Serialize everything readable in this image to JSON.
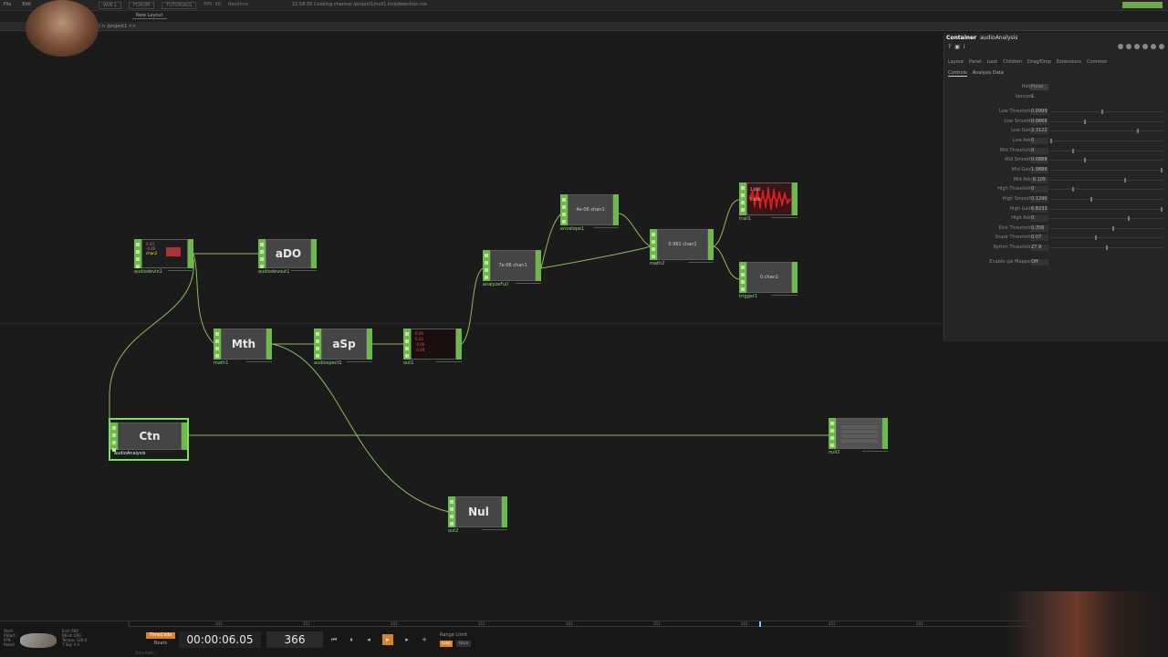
{
  "menubar": {
    "items": [
      "File",
      "Edit"
    ],
    "top_items": [
      "WIN 1",
      "FORUM",
      "TUTORIALS",
      "FPS: 60",
      "Realtime"
    ],
    "status": "22:58:55 Cooking channel /project1/null1 kickdetection.tox"
  },
  "tabs": {
    "new_layout": "New Layout"
  },
  "path": {
    "text": "/ > /project1 >>"
  },
  "nodes": {
    "audiodevin": {
      "label": "audiodevin1",
      "preview_lines": [
        "0.43",
        "-0.46",
        "chan2"
      ]
    },
    "ado": {
      "big": "aDO",
      "label": "audiodevout1"
    },
    "math1": {
      "big": "Mth",
      "label": "math1"
    },
    "asp": {
      "big": "aSp",
      "label": "audiospect1"
    },
    "out1": {
      "label": "out1",
      "preview_lines": [
        "0.40",
        "0.20",
        "-0.00",
        "-0.40"
      ]
    },
    "analyze": {
      "small": "7e-06 chan1",
      "label": "analyzeFull"
    },
    "envelope": {
      "small": "4e-06 chan1",
      "label": "envelope1"
    },
    "math2": {
      "small": "0.981 chan1",
      "label": "math2"
    },
    "trail": {
      "label": "trail1",
      "preview_lines": [
        "1.000",
        "0.000"
      ]
    },
    "trigger": {
      "small": "0 chan1",
      "label": "trigger1"
    },
    "ctn": {
      "big": "Ctn",
      "label": "audioAnalysis"
    },
    "null2": {
      "label": "null2"
    },
    "nul": {
      "big": "Nul",
      "label": "out2"
    }
  },
  "panel": {
    "title_prefix": "Container",
    "title_name": "audioAnalysis",
    "tabs": [
      "Layout",
      "Panel",
      "Look",
      "Children",
      "Drag/Drop",
      "Extensions",
      "Common"
    ],
    "subtabs": [
      "Controls",
      "Analysis Data"
    ],
    "help": {
      "label": "Help",
      "value": "Pulse"
    },
    "version": {
      "label": "Version",
      "value": "1"
    },
    "params": [
      {
        "label": "Low Threshold",
        "value": "0.0999",
        "knob": 0.46
      },
      {
        "label": "Low Smooth",
        "value": "0.0666",
        "knob": 0.3
      },
      {
        "label": "Low Gain",
        "value": "2.3122",
        "knob": 0.78
      },
      {
        "label": "Low Add",
        "value": "0",
        "knob": 0.0
      },
      {
        "label": "Mid Threshold",
        "value": "0",
        "knob": 0.2
      },
      {
        "label": "Mid Smooth",
        "value": "0.0888",
        "knob": 0.3
      },
      {
        "label": "Mid Gain",
        "value": "1.9888",
        "knob": 0.99
      },
      {
        "label": "Mid Add",
        "value": "-0.105",
        "knob": 0.66
      },
      {
        "label": "High Threshold",
        "value": "0",
        "knob": 0.2
      },
      {
        "label": "High Smooth",
        "value": "0.1296",
        "knob": 0.36
      },
      {
        "label": "High Gain",
        "value": "6.8233",
        "knob": 0.99
      },
      {
        "label": "High Add",
        "value": "0",
        "knob": 0.7
      },
      {
        "label": "Kick Threshold",
        "value": "0.356",
        "knob": 0.56
      },
      {
        "label": "Snare Threshold",
        "value": "0.07",
        "knob": 0.4
      },
      {
        "label": "Rythm Threshold",
        "value": "27.9",
        "knob": 0.5
      },
      {
        "label": "Enable gal Mapper",
        "value": "Off",
        "knob": null
      }
    ]
  },
  "timeline": {
    "ticks": [
      "1",
      "101",
      "151",
      "201",
      "251",
      "301",
      "351",
      "401",
      "451",
      "501"
    ],
    "timecode": "00:00:06.05",
    "frame": "366",
    "timecode_btn": "TimeCode",
    "beats_btn": "Beats",
    "range_limit": "Range Limit",
    "loop": "Loop",
    "once": "Once",
    "stats_left": [
      "Start:",
      "RStart:",
      "FPS:",
      "Reset:"
    ],
    "stats_right": [
      "End: 600",
      "REnd: 600",
      "Tempo: 120.0",
      "T Sig: 4 4"
    ],
    "status": "Time Path: /"
  },
  "colors": {
    "op_green": "#6fb84b",
    "selected": "#7fe05a",
    "accent_orange": "#d9822b",
    "wire": "#8dbb5a"
  }
}
